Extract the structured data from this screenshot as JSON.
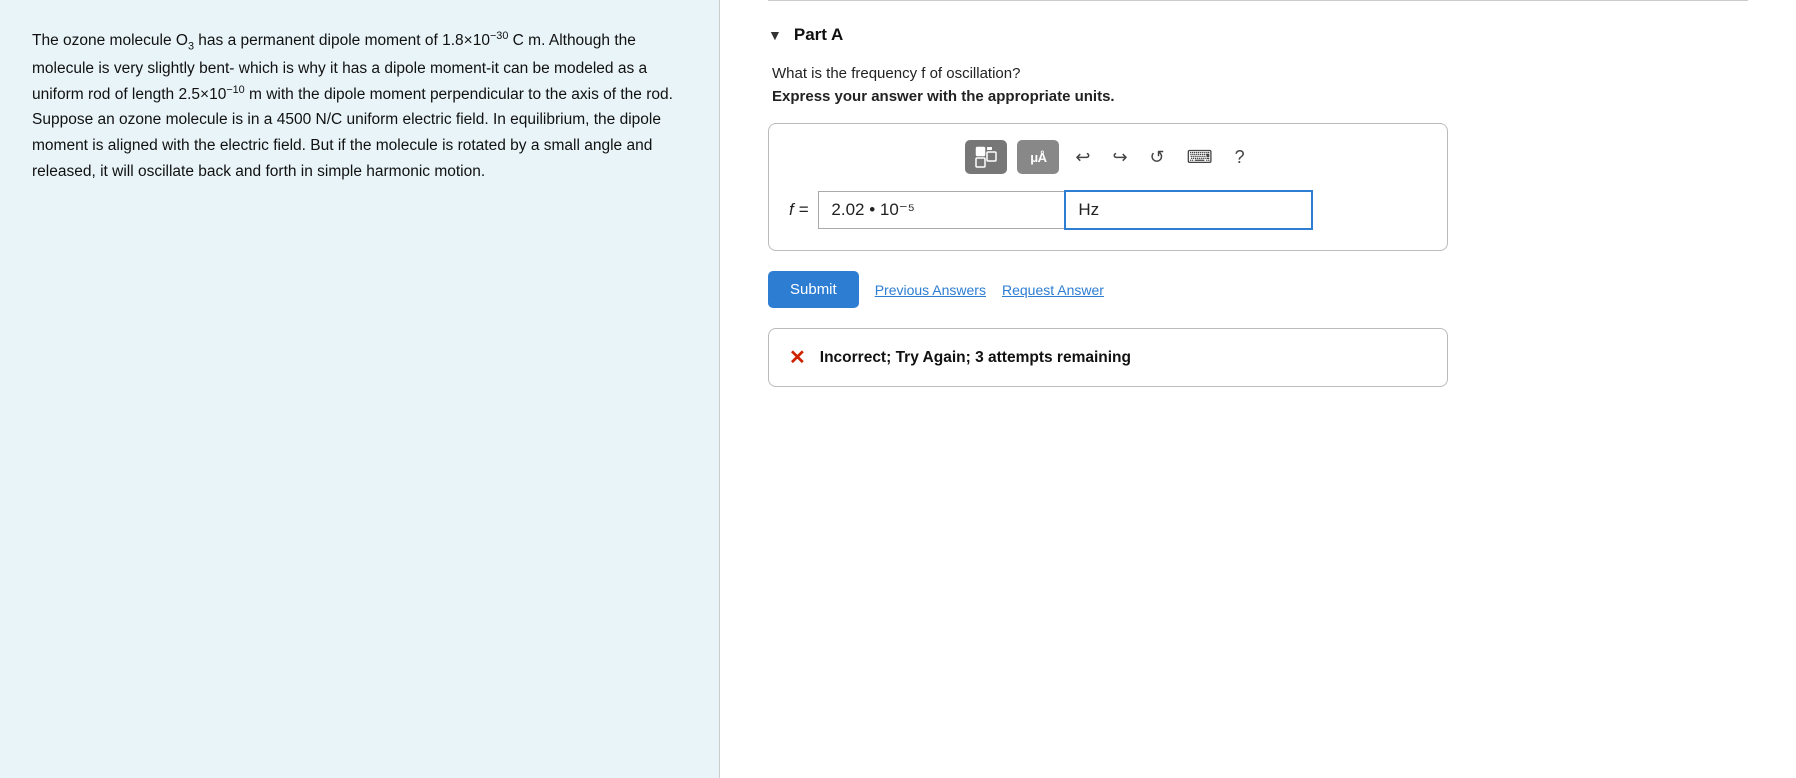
{
  "left": {
    "paragraph": "The ozone molecule O₃ has a permanent dipole moment of 1.8×10⁻³⁰ C m. Although the molecule is very slightly bent-which is why it has a dipole moment-it can be modeled as a uniform rod of length 2.5×10⁻¹⁰ m with the dipole moment perpendicular to the axis of the rod. Suppose an ozone molecule is in a 4500 N/C uniform electric field. In equilibrium, the dipole moment is aligned with the electric field. But if the molecule is rotated by a small angle and released, it will oscillate back and forth in simple harmonic motion."
  },
  "right": {
    "part_label": "Part A",
    "question": "What is the frequency f of oscillation?",
    "instruction": "Express your answer with the appropriate units.",
    "toolbar": {
      "squares_btn": "⊞",
      "mu_btn": "μÅ",
      "undo_icon": "↩",
      "redo_icon": "↪",
      "refresh_icon": "↻",
      "keyboard_icon": "⌨",
      "help_icon": "?"
    },
    "input": {
      "f_label": "f =",
      "value": "2.02 • 10",
      "value_main": "2.02 •",
      "base": "10",
      "exponent": "−5",
      "unit": "Hz"
    },
    "actions": {
      "submit_label": "Submit",
      "previous_answers_label": "Previous Answers",
      "request_answer_label": "Request Answer"
    },
    "feedback": {
      "icon": "✕",
      "text": "Incorrect; Try Again; 3 attempts remaining"
    }
  }
}
